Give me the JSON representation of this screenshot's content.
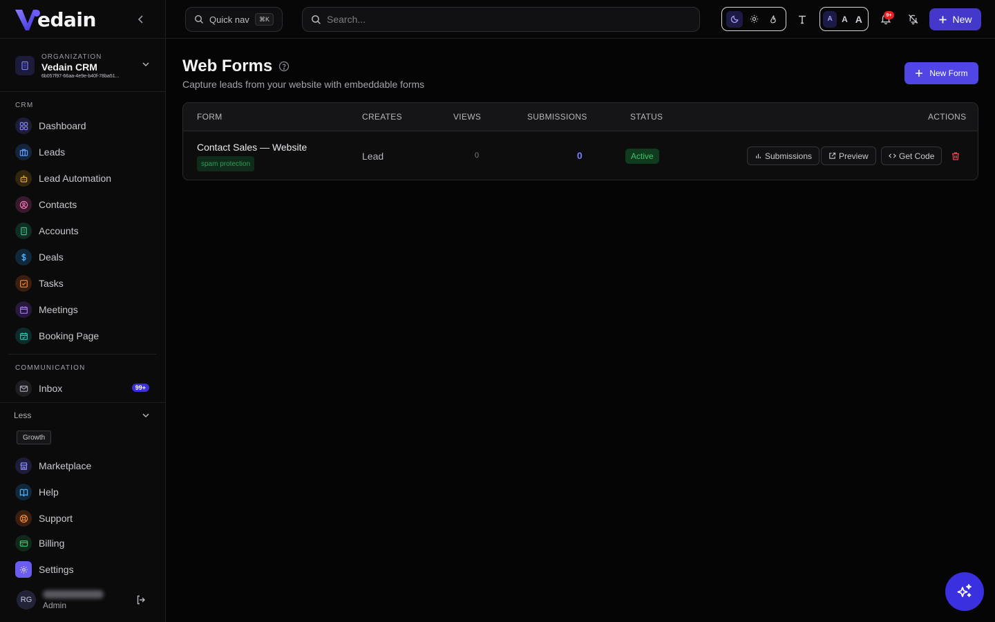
{
  "brand": {
    "name": "edain",
    "accent": "#4f46e5"
  },
  "organization": {
    "label": "ORGANIZATION",
    "name": "Vedain CRM",
    "id": "6b057f97-66aa-4e9e-b40f-78ba51..."
  },
  "sidebar": {
    "crm_label": "CRM",
    "crm_items": [
      {
        "label": "Dashboard",
        "icon": "grid-icon"
      },
      {
        "label": "Leads",
        "icon": "briefcase-icon"
      },
      {
        "label": "Lead Automation",
        "icon": "robot-icon"
      },
      {
        "label": "Contacts",
        "icon": "user-circle-icon"
      },
      {
        "label": "Accounts",
        "icon": "building-icon"
      },
      {
        "label": "Deals",
        "icon": "dollar-icon"
      },
      {
        "label": "Tasks",
        "icon": "checkbox-icon"
      },
      {
        "label": "Meetings",
        "icon": "calendar-icon"
      },
      {
        "label": "Booking Page",
        "icon": "calendar-check-icon"
      }
    ],
    "communication_label": "COMMUNICATION",
    "inbox": {
      "label": "Inbox",
      "badge": "99+"
    },
    "less_label": "Less",
    "growth_tag": "Growth",
    "extra_items": [
      {
        "label": "Marketplace",
        "icon": "store-icon"
      },
      {
        "label": "Help",
        "icon": "book-icon"
      },
      {
        "label": "Support",
        "icon": "lifebuoy-icon"
      },
      {
        "label": "Billing",
        "icon": "credit-card-icon"
      },
      {
        "label": "Settings",
        "icon": "gear-icon"
      }
    ],
    "user": {
      "initials": "RG",
      "role": "Admin"
    }
  },
  "topbar": {
    "quicknav_label": "Quick nav",
    "quicknav_shortcut": "⌘K",
    "search_placeholder": "Search...",
    "font_sizes": [
      "A",
      "A",
      "A"
    ],
    "notification_badge": "9+",
    "new_label": "New"
  },
  "page": {
    "title": "Web Forms",
    "subtitle": "Capture leads from your website with embeddable forms",
    "new_form_label": "New Form"
  },
  "table": {
    "columns": [
      "FORM",
      "CREATES",
      "VIEWS",
      "SUBMISSIONS",
      "STATUS",
      "ACTIONS"
    ],
    "rows": [
      {
        "form": "Contact Sales — Website",
        "tag": "spam protection",
        "creates": "Lead",
        "views": "0",
        "submissions": "0",
        "status": "Active",
        "actions": [
          "Submissions",
          "Preview",
          "Get Code"
        ]
      }
    ]
  }
}
